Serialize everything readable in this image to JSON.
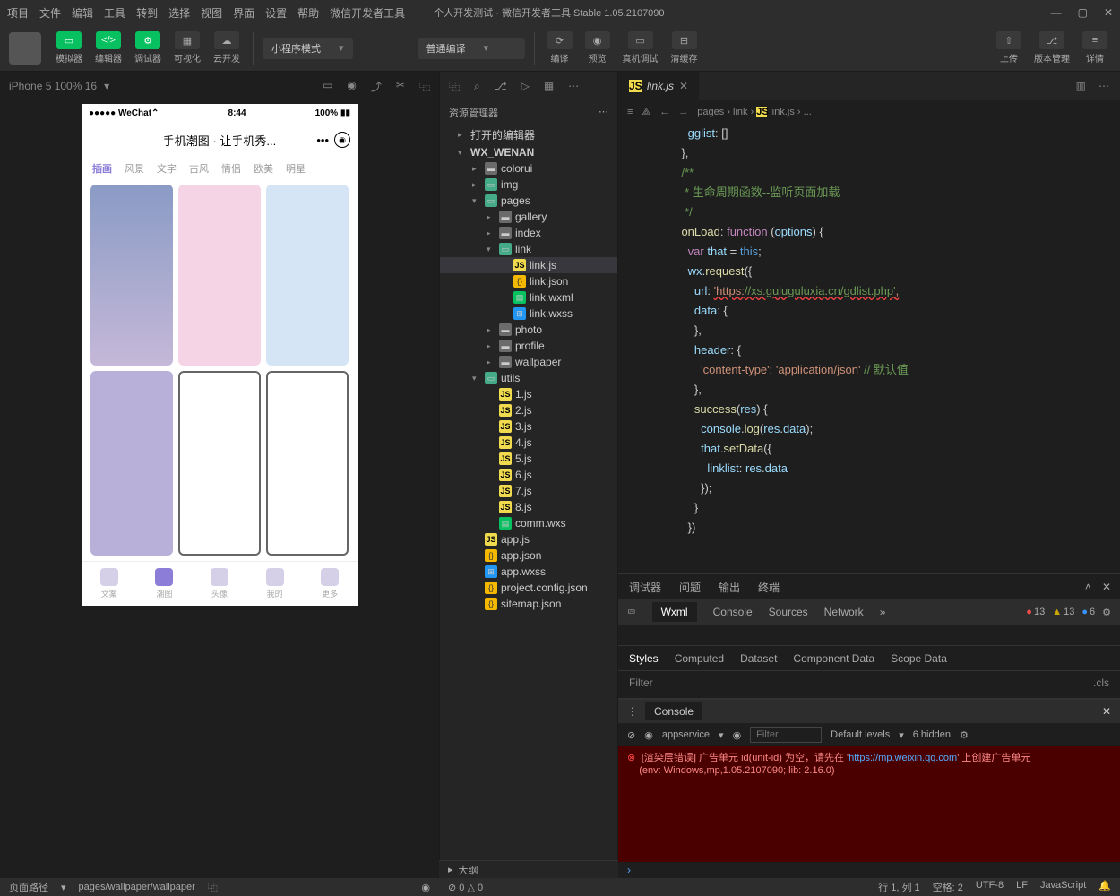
{
  "menu": [
    "项目",
    "文件",
    "编辑",
    "工具",
    "转到",
    "选择",
    "视图",
    "界面",
    "设置",
    "帮助",
    "微信开发者工具"
  ],
  "window_title": "个人开发测试 · 微信开发者工具 Stable 1.05.2107090",
  "toolbar": {
    "groups": [
      {
        "label": "模拟器",
        "icon": "▭",
        "green": true
      },
      {
        "label": "编辑器",
        "icon": "</>",
        "green": true
      },
      {
        "label": "调试器",
        "icon": "⚙",
        "green": true
      },
      {
        "label": "可视化",
        "icon": "▦"
      },
      {
        "label": "云开发",
        "icon": "☁"
      }
    ],
    "mode_select": "小程序模式",
    "compile_select": "普通编译",
    "actions": [
      {
        "label": "编译",
        "icon": "⟳"
      },
      {
        "label": "预览",
        "icon": "◉"
      },
      {
        "label": "真机调试",
        "icon": "▭"
      },
      {
        "label": "清缓存",
        "icon": "⊟"
      }
    ],
    "right": [
      {
        "label": "上传",
        "icon": "⇧"
      },
      {
        "label": "版本管理",
        "icon": "⎇"
      },
      {
        "label": "详情",
        "icon": "≡"
      }
    ]
  },
  "sim": {
    "device": "iPhone 5 100% 16",
    "phone": {
      "carrier": "●●●●● WeChat",
      "wifi": "⌃",
      "time": "8:44",
      "battery": "100%",
      "title": "手机潮图 · 让手机秀...",
      "tabs": [
        "插画",
        "风景",
        "文字",
        "古风",
        "情侣",
        "欧美",
        "明星"
      ],
      "nav": [
        "文案",
        "潮图",
        "头像",
        "我的",
        "更多"
      ],
      "nav_active": 1
    }
  },
  "explorer": {
    "title": "资源管理器",
    "sections": [
      "打开的编辑器",
      "WX_WENAN"
    ],
    "tree": [
      {
        "l": 2,
        "t": "folder",
        "n": "colorui"
      },
      {
        "l": 2,
        "t": "folder-o",
        "n": "img"
      },
      {
        "l": 2,
        "t": "folder-o",
        "n": "pages",
        "open": true
      },
      {
        "l": 3,
        "t": "folder",
        "n": "gallery"
      },
      {
        "l": 3,
        "t": "folder",
        "n": "index"
      },
      {
        "l": 3,
        "t": "folder-o",
        "n": "link",
        "open": true
      },
      {
        "l": 4,
        "t": "js",
        "n": "link.js",
        "sel": true
      },
      {
        "l": 4,
        "t": "json",
        "n": "link.json"
      },
      {
        "l": 4,
        "t": "wxml",
        "n": "link.wxml"
      },
      {
        "l": 4,
        "t": "wxss",
        "n": "link.wxss"
      },
      {
        "l": 3,
        "t": "folder",
        "n": "photo"
      },
      {
        "l": 3,
        "t": "folder",
        "n": "profile"
      },
      {
        "l": 3,
        "t": "folder",
        "n": "wallpaper"
      },
      {
        "l": 2,
        "t": "folder-o",
        "n": "utils",
        "open": true
      },
      {
        "l": 3,
        "t": "js",
        "n": "1.js"
      },
      {
        "l": 3,
        "t": "js",
        "n": "2.js"
      },
      {
        "l": 3,
        "t": "js",
        "n": "3.js"
      },
      {
        "l": 3,
        "t": "js",
        "n": "4.js"
      },
      {
        "l": 3,
        "t": "js",
        "n": "5.js"
      },
      {
        "l": 3,
        "t": "js",
        "n": "6.js"
      },
      {
        "l": 3,
        "t": "js",
        "n": "7.js"
      },
      {
        "l": 3,
        "t": "js",
        "n": "8.js"
      },
      {
        "l": 3,
        "t": "wxml",
        "n": "comm.wxs"
      },
      {
        "l": 2,
        "t": "js",
        "n": "app.js"
      },
      {
        "l": 2,
        "t": "json",
        "n": "app.json"
      },
      {
        "l": 2,
        "t": "wxss",
        "n": "app.wxss"
      },
      {
        "l": 2,
        "t": "json",
        "n": "project.config.json"
      },
      {
        "l": 2,
        "t": "json",
        "n": "sitemap.json"
      }
    ],
    "outline": "大纲"
  },
  "editor": {
    "tab": "link.js",
    "breadcrumb": [
      "pages",
      "link",
      "link.js",
      "..."
    ],
    "code_lines": [
      "      gglist: []",
      "    },",
      "",
      "    /**",
      "     * 生命周期函数--监听页面加载",
      "     */",
      "    onLoad: function (options) {",
      "      var that = this;",
      "      wx.request({",
      "        url: 'https://xs.guluguluxia.cn/gdlist.php',",
      "        data: {",
      "        },",
      "        header: {",
      "          'content-type': 'application/json' // 默认值",
      "        },",
      "        success(res) {",
      "          console.log(res.data);",
      "          that.setData({",
      "            linklist: res.data",
      "          });",
      "        }",
      "      })"
    ]
  },
  "devtools": {
    "top_tabs": [
      "调试器",
      "问题",
      "输出",
      "终端"
    ],
    "panel_tabs": [
      "Wxml",
      "Console",
      "Sources",
      "Network"
    ],
    "badges": {
      "err": "13",
      "warn": "13",
      "info": "6"
    },
    "style_tabs": [
      "Styles",
      "Computed",
      "Dataset",
      "Component Data",
      "Scope Data"
    ],
    "filter": "Filter",
    "cls": ".cls",
    "console": {
      "tab": "Console",
      "context": "appservice",
      "filter_ph": "Filter",
      "levels": "Default levels",
      "hidden": "6 hidden",
      "error1": "[渲染层错误] 广告单元 id(unit-id) 为空，请先在 '",
      "error_url": "https://mp.weixin.qq.com",
      "error2": "' 上创建广告单元",
      "env": "(env: Windows,mp,1.05.2107090; lib: 2.16.0)"
    }
  },
  "status": {
    "left_label": "页面路径",
    "path": "pages/wallpaper/wallpaper",
    "counts": "⊘ 0 △ 0",
    "pos": "行 1, 列 1",
    "spaces": "空格: 2",
    "enc": "UTF-8",
    "eol": "LF",
    "lang": "JavaScript"
  }
}
